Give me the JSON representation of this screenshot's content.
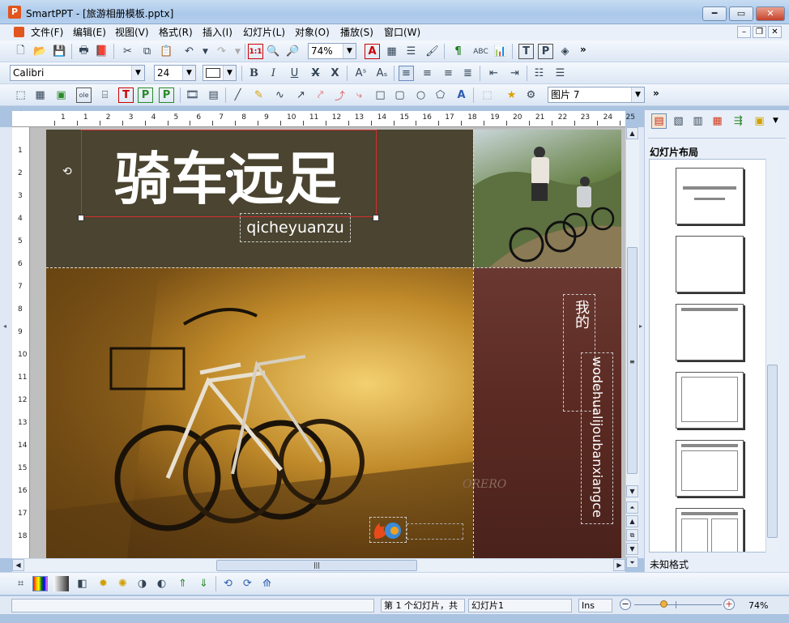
{
  "window": {
    "title": "SmartPPT - [旅游相册模板.pptx]",
    "app_icon": "P"
  },
  "menu": [
    "文件(F)",
    "编辑(E)",
    "视图(V)",
    "格式(R)",
    "插入(I)",
    "幻灯片(L)",
    "对象(O)",
    "播放(S)",
    "窗口(W)"
  ],
  "toolbar": {
    "zoom": "74%",
    "font": "Calibri",
    "font_size": "24",
    "object_select": "图片 7",
    "more": "»"
  },
  "slide": {
    "title": "骑车远足",
    "subtitle": "qicheyuanzu",
    "vertical_label": "我的",
    "vertical_text": "wodehualijoubanxiangce",
    "watermark": "ORERO",
    "colors": {
      "dark_band": "#4a4430",
      "maroon": "#5a2a22"
    }
  },
  "ruler": {
    "h": [
      "1",
      "1",
      "2",
      "3",
      "4",
      "5",
      "6",
      "7",
      "8",
      "9",
      "10",
      "11",
      "12",
      "13",
      "14",
      "15",
      "16",
      "17",
      "18",
      "19",
      "20",
      "21",
      "22",
      "23",
      "24",
      "25"
    ],
    "v": [
      "1",
      "2",
      "3",
      "4",
      "5",
      "6",
      "7",
      "8",
      "9",
      "10",
      "11",
      "12",
      "13",
      "14",
      "15",
      "16",
      "17",
      "18"
    ]
  },
  "panel": {
    "title": "幻灯片布局",
    "footer": "未知格式"
  },
  "status": {
    "slide_info": "第 1 个幻灯片，共",
    "slide_name": "幻灯片1",
    "mode": "Ins",
    "zoom": "74%"
  }
}
